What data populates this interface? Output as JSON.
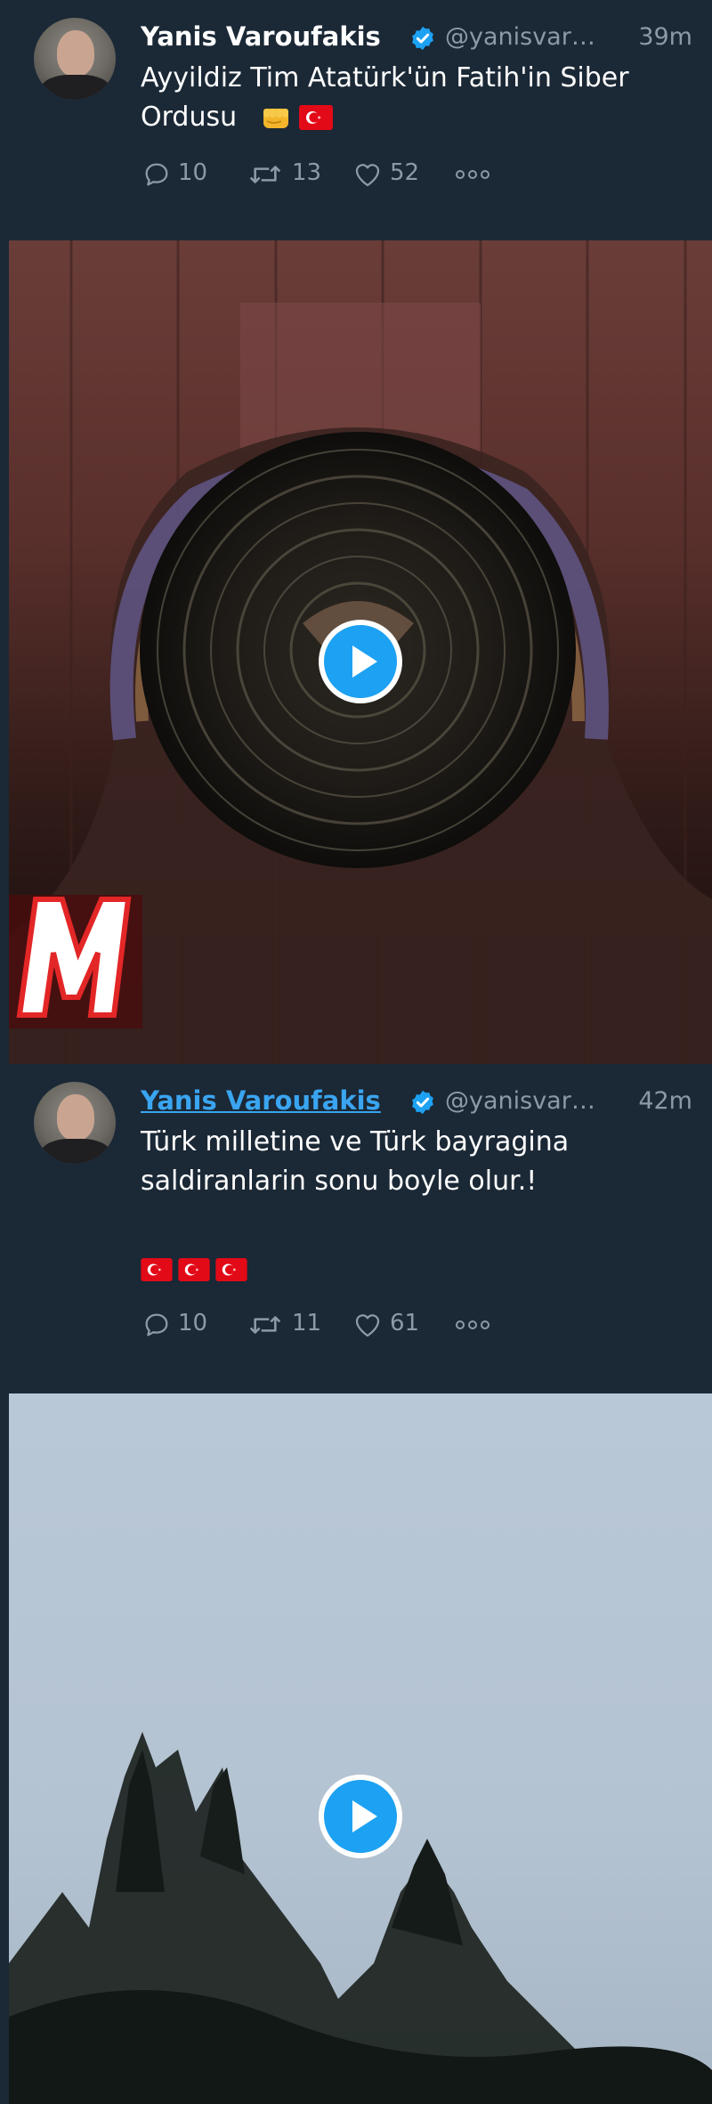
{
  "tweets": [
    {
      "author_name": "Yanis Varoufakis",
      "handle": "@yanisvar…",
      "time": "39m",
      "text_line1": "Ayyildiz Tim Atatürk'ün Fatih'in Siber",
      "text_line2": "Ordusu",
      "replies": "10",
      "retweets": "13",
      "likes": "52",
      "media_caption": "M"
    },
    {
      "author_name": "Yanis Varoufakis",
      "handle": "@yanisvar…",
      "time": "42m",
      "text_line1": "Türk milletine ve Türk bayragina",
      "text_line2": "saldiranlarin sonu boyle olur.!",
      "replies": "10",
      "retweets": "11",
      "likes": "61"
    }
  ],
  "colors": {
    "background": "#1b2836",
    "secondary_text": "#8d9aa6",
    "accent": "#1da1f2",
    "verified": "#1da1f2",
    "flag_red": "#e30a17"
  },
  "icons": [
    "verified-badge-icon",
    "reply-icon",
    "retweet-icon",
    "like-icon",
    "more-icon",
    "play-icon",
    "fist-emoji-icon",
    "turkey-flag-icon"
  ]
}
